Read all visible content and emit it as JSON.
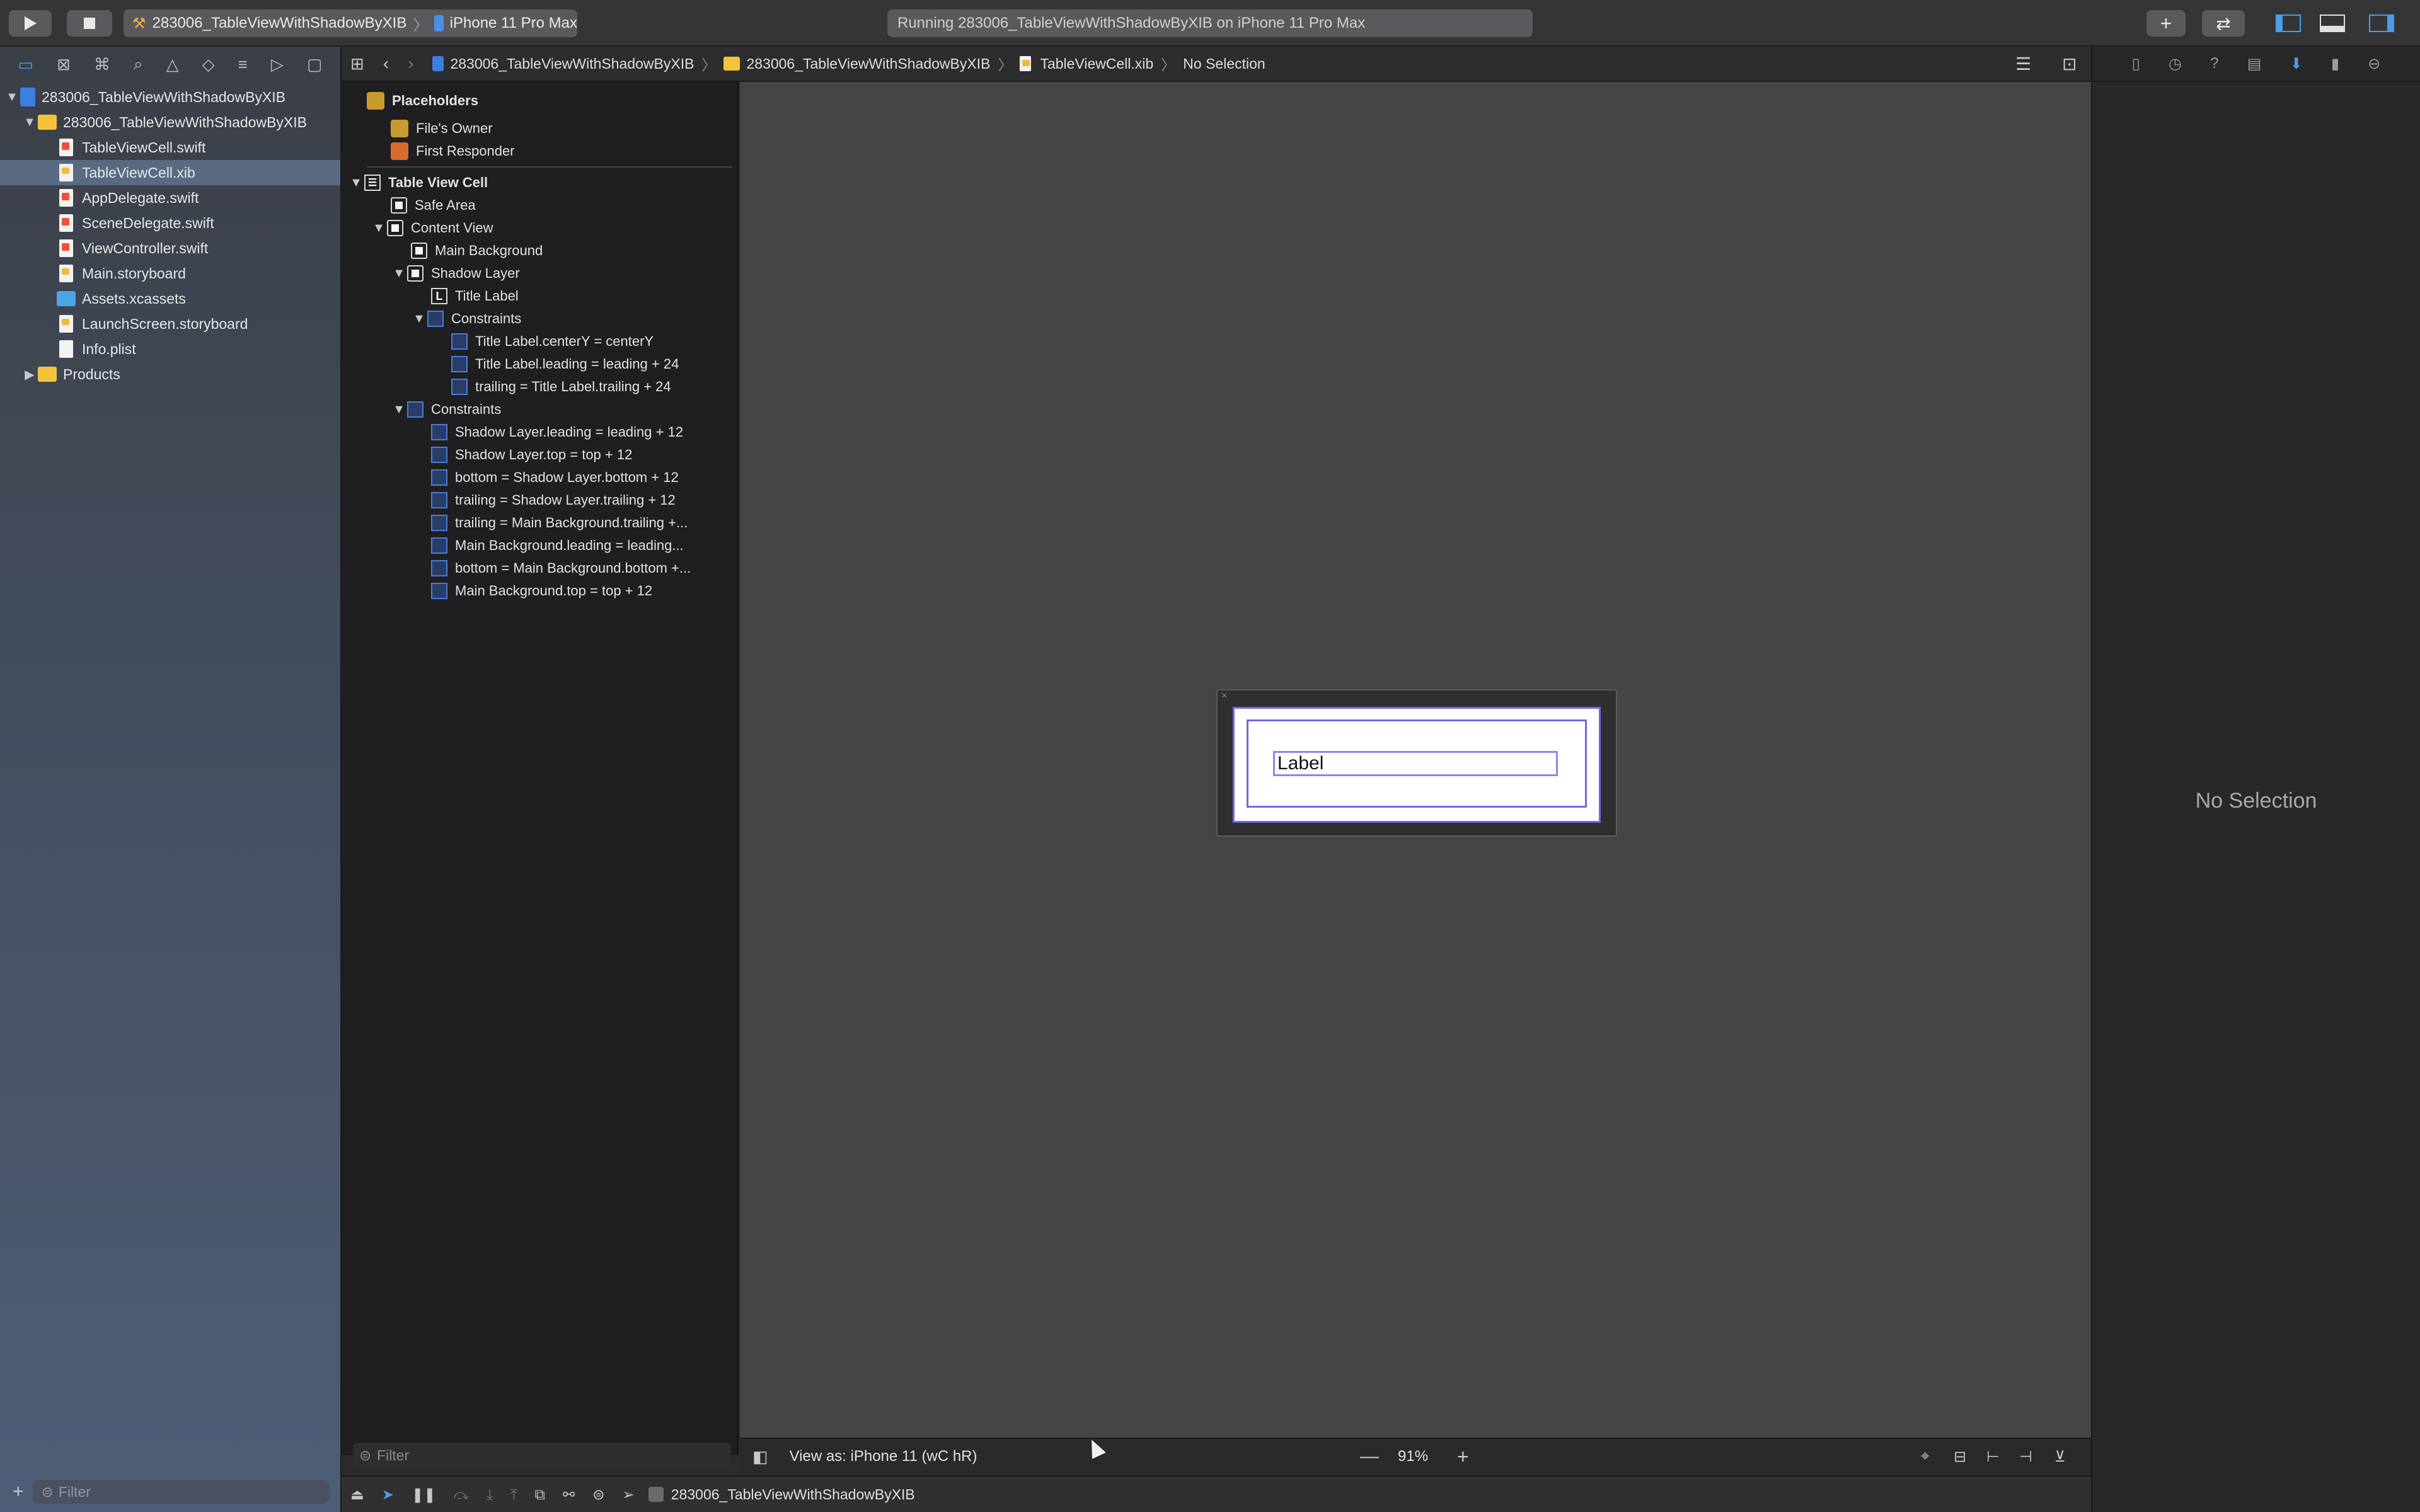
{
  "toolbar": {
    "scheme": "283006_TableViewWithShadowByXIB",
    "destination": "iPhone 11 Pro Max",
    "activity": "Running 283006_TableViewWithShadowByXIB on iPhone 11 Pro Max"
  },
  "navigator": {
    "project": "283006_TableViewWithShadowByXIB",
    "group": "283006_TableViewWithShadowByXIB",
    "files": [
      "TableViewCell.swift",
      "TableViewCell.xib",
      "AppDelegate.swift",
      "SceneDelegate.swift",
      "ViewController.swift",
      "Main.storyboard",
      "Assets.xcassets",
      "LaunchScreen.storyboard",
      "Info.plist"
    ],
    "products": "Products",
    "filter_placeholder": "Filter"
  },
  "jumpbar": {
    "project": "283006_TableViewWithShadowByXIB",
    "group": "283006_TableViewWithShadowByXIB",
    "file": "TableViewCell.xib",
    "selection": "No Selection"
  },
  "outline": {
    "placeholders": "Placeholders",
    "files_owner": "File's Owner",
    "first_responder": "First Responder",
    "table_view_cell": "Table View Cell",
    "safe_area": "Safe Area",
    "content_view": "Content View",
    "main_background": "Main Background",
    "shadow_layer": "Shadow Layer",
    "title_label": "Title Label",
    "constraints": "Constraints",
    "inner_constraints": [
      "Title Label.centerY = centerY",
      "Title Label.leading = leading + 24",
      "trailing = Title Label.trailing + 24"
    ],
    "outer_constraints": [
      "Shadow Layer.leading = leading + 12",
      "Shadow Layer.top = top + 12",
      "bottom = Shadow Layer.bottom + 12",
      "trailing = Shadow Layer.trailing + 12",
      "trailing = Main Background.trailing +...",
      "Main Background.leading = leading...",
      "bottom = Main Background.bottom +...",
      "Main Background.top = top + 12"
    ],
    "filter_placeholder": "Filter"
  },
  "canvas": {
    "label_text": "Label",
    "view_as": "View as: iPhone 11 (wC hR)",
    "zoom": "91%"
  },
  "debugbar": {
    "target": "283006_TableViewWithShadowByXIB"
  },
  "inspector": {
    "empty_state": "No Selection"
  }
}
